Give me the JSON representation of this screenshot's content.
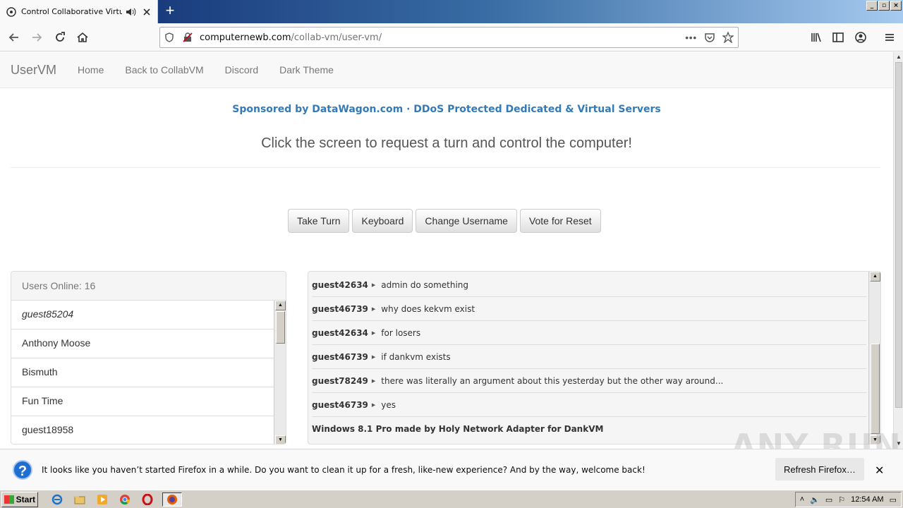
{
  "browser": {
    "tab_title": "Control Collaborative Virtual M",
    "url_domain": "computernewb.com",
    "url_path": "/collab-vm/user-vm/"
  },
  "site": {
    "brand": "UserVM",
    "nav": [
      "Home",
      "Back to CollabVM",
      "Discord",
      "Dark Theme"
    ],
    "sponsor": "Sponsored by DataWagon.com · DDoS Protected Dedicated & Virtual Servers",
    "headline": "Click the screen to request a turn and control the computer!",
    "buttons": [
      "Take Turn",
      "Keyboard",
      "Change Username",
      "Vote for Reset"
    ]
  },
  "users": {
    "header": "Users Online: 16",
    "list": [
      "guest85204",
      "Anthony Moose",
      "Bismuth",
      "Fun Time",
      "guest18958"
    ]
  },
  "chat": {
    "messages": [
      {
        "user": "guest42634",
        "text": "admin do something"
      },
      {
        "user": "guest46739",
        "text": "why does kekvm exist"
      },
      {
        "user": "guest42634",
        "text": "for losers"
      },
      {
        "user": "guest46739",
        "text": "if dankvm exists"
      },
      {
        "user": "guest78249",
        "text": "there was literally an argument about this yesterday but the other way around..."
      },
      {
        "user": "guest46739",
        "text": "yes"
      }
    ],
    "system": "Windows 8.1 Pro made by Holy Network Adapter for DankVM"
  },
  "notification": {
    "message": "It looks like you haven’t started Firefox in a while. Do you want to clean it up for a fresh, like-new experience? And by the way, welcome back!",
    "refresh_label": "Refresh Firefox…"
  },
  "watermark": "ANY RUN",
  "taskbar": {
    "start_label": "Start",
    "clock": "12:54 AM"
  }
}
